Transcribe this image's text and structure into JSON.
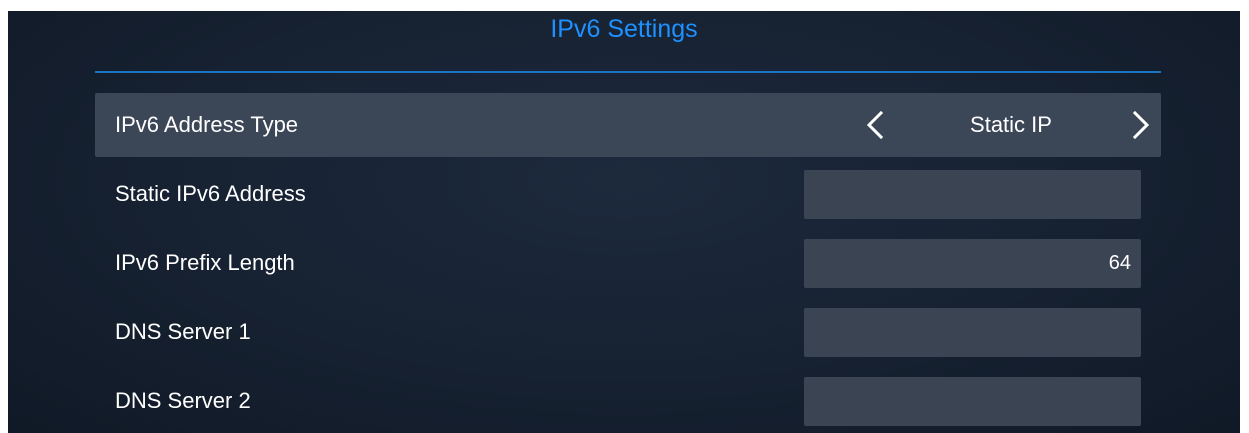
{
  "header": {
    "title": "IPv6 Settings"
  },
  "rows": [
    {
      "label": "IPv6 Address Type",
      "type": "selector",
      "value": "Static IP",
      "selected": true
    },
    {
      "label": "Static IPv6 Address",
      "type": "input",
      "value": ""
    },
    {
      "label": "IPv6 Prefix Length",
      "type": "input",
      "value": "64"
    },
    {
      "label": "DNS Server 1",
      "type": "input",
      "value": ""
    },
    {
      "label": "DNS Server 2",
      "type": "input",
      "value": ""
    }
  ],
  "icons": {
    "prev": "chevron-left-icon",
    "next": "chevron-right-icon"
  },
  "colors": {
    "accent": "#1e90ff",
    "divider": "#1a74c4",
    "background": "#162131",
    "selected_row": "#3b4657",
    "field": "#3a4453",
    "text": "#ffffff"
  }
}
